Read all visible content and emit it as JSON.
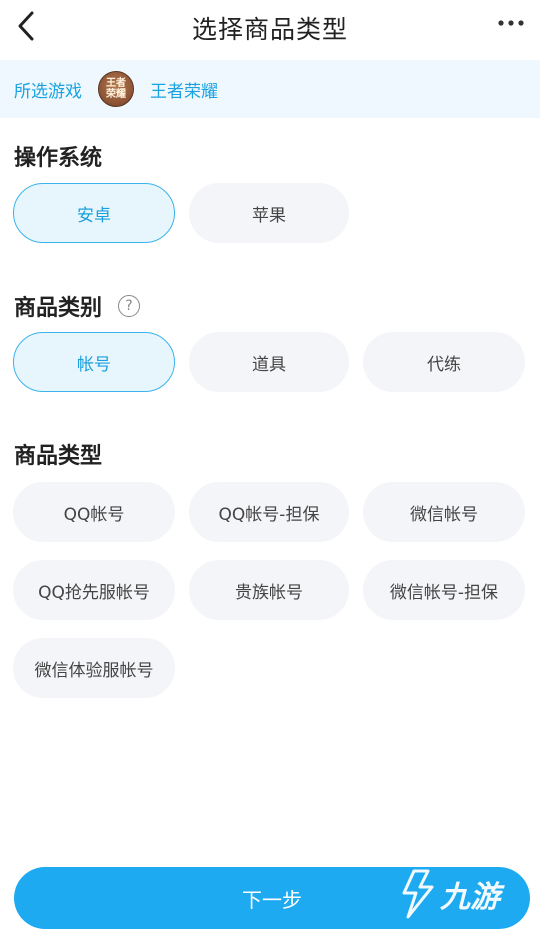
{
  "header": {
    "title": "选择商品类型",
    "back_icon": "chevron-left-icon",
    "more_icon": "more-horizontal-icon"
  },
  "game_bar": {
    "label": "所选游戏",
    "logo_text_line1": "王者",
    "logo_text_line2": "荣耀",
    "game_name": "王者荣耀"
  },
  "os_section": {
    "title": "操作系统",
    "options": [
      {
        "label": "安卓",
        "selected": true
      },
      {
        "label": "苹果",
        "selected": false
      }
    ]
  },
  "category_section": {
    "title": "商品类别",
    "help_icon": "?",
    "options": [
      {
        "label": "帐号",
        "selected": true
      },
      {
        "label": "道具",
        "selected": false
      },
      {
        "label": "代练",
        "selected": false
      }
    ]
  },
  "type_section": {
    "title": "商品类型",
    "options": [
      {
        "label": "QQ帐号"
      },
      {
        "label": "QQ帐号-担保"
      },
      {
        "label": "微信帐号"
      },
      {
        "label": "QQ抢先服帐号"
      },
      {
        "label": "贵族帐号"
      },
      {
        "label": "微信帐号-担保"
      },
      {
        "label": "微信体验服帐号"
      }
    ]
  },
  "footer": {
    "next_label": "下一步",
    "watermark_text": "九游"
  },
  "colors": {
    "accent": "#1eaaf1",
    "accent_text": "#1a9fdc",
    "chip_bg": "#f4f5f8",
    "selected_bg": "#e7f6fd",
    "game_bar_bg": "#eef8fe"
  }
}
